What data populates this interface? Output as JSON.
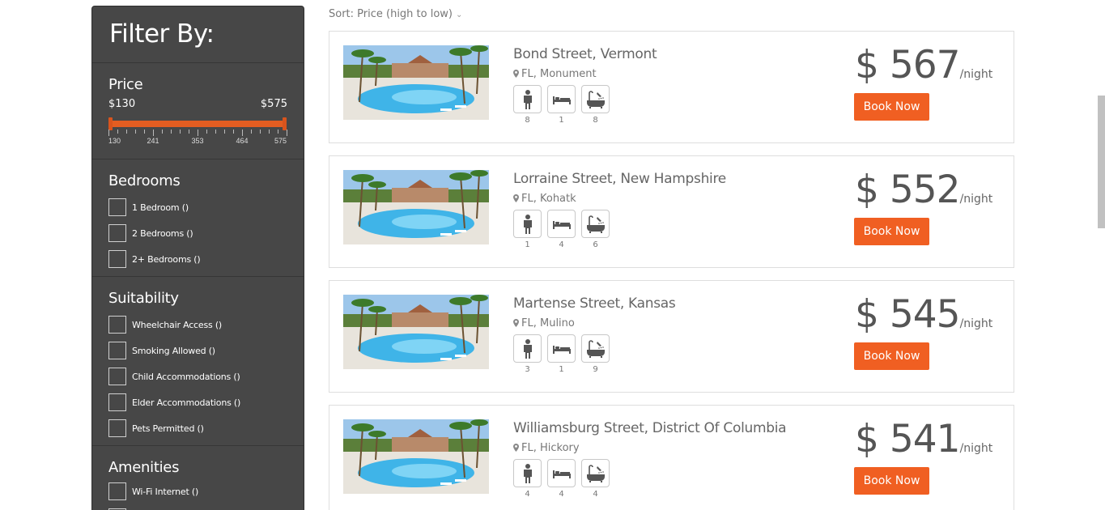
{
  "sidebar": {
    "title": "Filter By:",
    "price": {
      "heading": "Price",
      "min_label": "$130",
      "max_label": "$575",
      "ticks": [
        "130",
        "241",
        "353",
        "464",
        "575"
      ]
    },
    "bedrooms": {
      "heading": "Bedrooms",
      "options": [
        "1 Bedroom ()",
        "2 Bedrooms ()",
        "2+ Bedrooms ()"
      ]
    },
    "suitability": {
      "heading": "Suitability",
      "options": [
        "Wheelchair Access ()",
        "Smoking Allowed ()",
        "Child Accommodations ()",
        "Elder Accommodations ()",
        "Pets Permitted ()"
      ]
    },
    "amenities": {
      "heading": "Amenities",
      "options": [
        "Wi-Fi Internet ()"
      ]
    }
  },
  "sort": {
    "label": "Sort: Price (high to low)"
  },
  "listings": [
    {
      "street": "Bond Street, Vermont",
      "location": "FL, Monument",
      "guests": "8",
      "beds": "1",
      "baths": "8",
      "price": "$ 567",
      "per": "/night",
      "book": "Book Now"
    },
    {
      "street": "Lorraine Street, New Hampshire",
      "location": "FL, Kohatk",
      "guests": "1",
      "beds": "4",
      "baths": "6",
      "price": "$ 552",
      "per": "/night",
      "book": "Book Now"
    },
    {
      "street": "Martense Street, Kansas",
      "location": "FL, Mulino",
      "guests": "3",
      "beds": "1",
      "baths": "9",
      "price": "$ 545",
      "per": "/night",
      "book": "Book Now"
    },
    {
      "street": "Williamsburg Street, District Of Columbia",
      "location": "FL, Hickory",
      "guests": "4",
      "beds": "4",
      "baths": "4",
      "price": "$ 541",
      "per": "/night",
      "book": "Book Now"
    }
  ],
  "icons": {
    "guests": "person-icon",
    "beds": "bed-icon",
    "baths": "bathtub-icon",
    "location": "map-pin-icon"
  },
  "colors": {
    "accent": "#f05f22",
    "sidebar_bg": "#474747"
  }
}
